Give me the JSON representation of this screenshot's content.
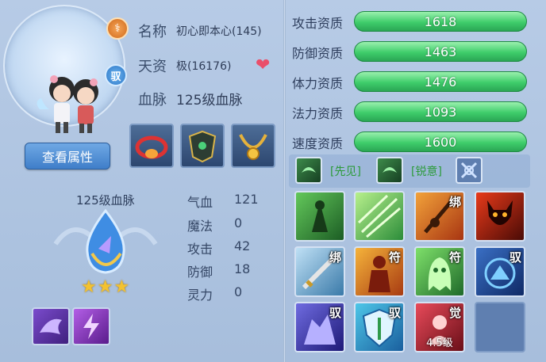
{
  "pet": {
    "name_label": "名称",
    "name_value": "初心即本心(145)",
    "talent_label": "天资",
    "talent_value": "极(16176)",
    "bloodline_label": "血脉",
    "bloodline_value": "125级血脉",
    "badge_top": "⚕",
    "badge_ride": "驭"
  },
  "buttons": {
    "view_attributes": "查看属性"
  },
  "bloodline_panel": {
    "title": "125级血脉",
    "stars": "★★★",
    "star_count": 3
  },
  "stats": [
    {
      "label": "气血",
      "value": "121"
    },
    {
      "label": "魔法",
      "value": "0"
    },
    {
      "label": "攻击",
      "value": "42"
    },
    {
      "label": "防御",
      "value": "18"
    },
    {
      "label": "灵力",
      "value": "0"
    }
  ],
  "aptitudes": [
    {
      "label": "攻击资质",
      "value": "1618"
    },
    {
      "label": "防御资质",
      "value": "1463"
    },
    {
      "label": "体力资质",
      "value": "1476"
    },
    {
      "label": "法力资质",
      "value": "1093"
    },
    {
      "label": "速度资质",
      "value": "1600"
    }
  ],
  "traits": [
    {
      "label": "[先见]"
    },
    {
      "label": "[锐意]"
    }
  ],
  "skills": [
    {
      "tag": "",
      "level": ""
    },
    {
      "tag": "",
      "level": ""
    },
    {
      "tag": "绑",
      "level": ""
    },
    {
      "tag": "",
      "level": ""
    },
    {
      "tag": "绑",
      "level": ""
    },
    {
      "tag": "符",
      "level": ""
    },
    {
      "tag": "符",
      "level": ""
    },
    {
      "tag": "驭",
      "level": ""
    },
    {
      "tag": "驭",
      "level": ""
    },
    {
      "tag": "驭",
      "level": ""
    },
    {
      "tag": "觉",
      "level": "4.5级"
    }
  ],
  "colors": {
    "aptitude_bar": "#3fcd6b",
    "panel_bg": "#a9c1df",
    "trait_text": "#2c9b3a"
  }
}
